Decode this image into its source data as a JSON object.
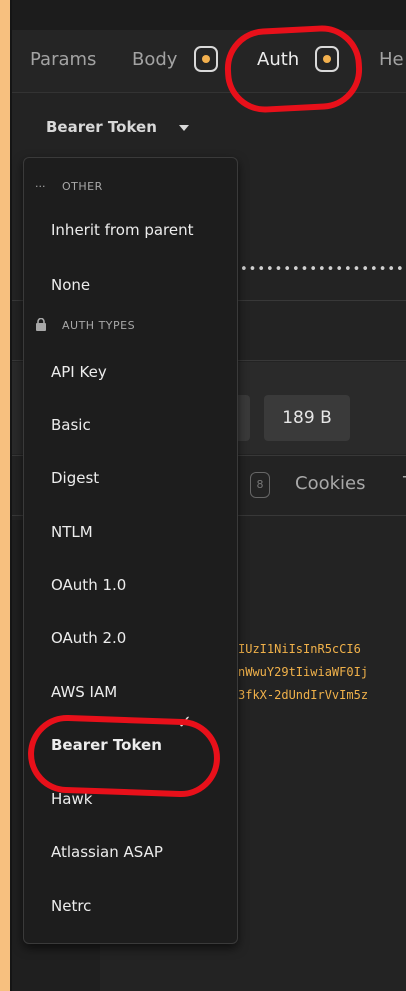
{
  "tabs": [
    {
      "label": "Params"
    },
    {
      "label": "Body"
    },
    {
      "label": "Auth"
    },
    {
      "label": "He"
    }
  ],
  "auth_type_label": "Bearer Token",
  "background": {
    "token_dots": "••••••••••••••••••••",
    "response_size": "189 B",
    "response_tab_count": "8",
    "cookies_tab": "Cookies",
    "cut_tab": "T",
    "code_lines": [
      "IUzI1NiIsInR5cCI6",
      "nWwuY29tIiwiaWF0Ij",
      "3fkX-2dUndIrVvIm5z"
    ]
  },
  "menu": {
    "other_section": "OTHER",
    "auth_types_section": "AUTH TYPES",
    "other_items": [
      "Inherit from parent",
      "None"
    ],
    "auth_items": [
      "API Key",
      "Basic",
      "Digest",
      "NTLM",
      "OAuth 1.0",
      "OAuth 2.0",
      "AWS IAM",
      "Bearer Token",
      "Hawk",
      "Atlassian ASAP",
      "Netrc"
    ],
    "selected": "Bearer Token",
    "check_mark": "✓"
  },
  "icons": {
    "other": "dots-icon",
    "auth_types": "lock-icon",
    "caret": "chevron-down-icon"
  },
  "colors": {
    "background": "#f7c07f",
    "accent_dot": "#f2b04e",
    "annotation": "#e8101a",
    "app_bg": "#232323"
  }
}
